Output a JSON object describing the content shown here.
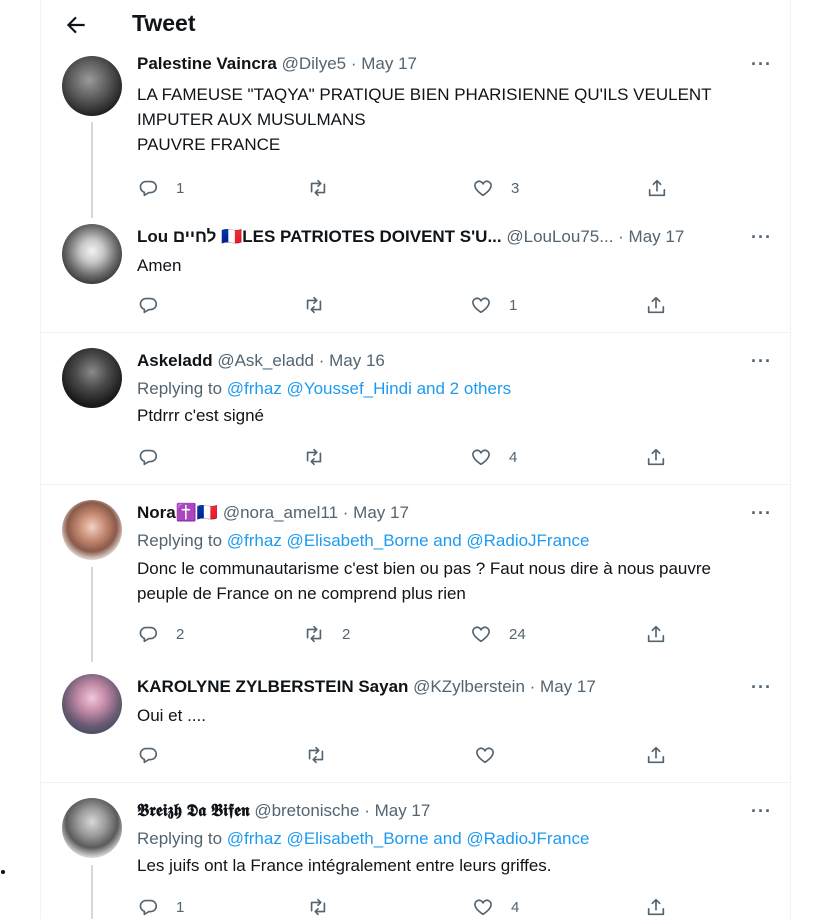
{
  "header": {
    "title": "Tweet"
  },
  "tweets": [
    {
      "name": "Palestine Vaincra",
      "handle": "@Dilye5",
      "date": "· May 17",
      "reply_prefix": "",
      "reply_links": "",
      "lines": [
        "LA FAMEUSE \"TAQYA\" PRATIQUE BIEN PHARISIENNE QU'ILS VEULENT",
        "IMPUTER AUX MUSULMANS",
        "PAUVRE FRANCE"
      ],
      "replies": "1",
      "retweets": "",
      "likes": "3"
    },
    {
      "name": "Lou לחיים 🇫🇷LES PATRIOTES DOIVENT S'U...",
      "handle": "@LouLou75...",
      "date": "· May 17",
      "reply_prefix": "",
      "reply_links": "",
      "lines": [
        "Amen"
      ],
      "replies": "",
      "retweets": "",
      "likes": "1"
    },
    {
      "name": "Askeladd",
      "handle": "@Ask_eladd",
      "date": "· May 16",
      "reply_prefix": "Replying to ",
      "reply_links": "@frhaz @Youssef_Hindi and 2 others",
      "lines": [
        "Ptdrrr c'est signé"
      ],
      "replies": "",
      "retweets": "",
      "likes": "4"
    },
    {
      "name": "Nora✝️🇫🇷",
      "handle": "@nora_amel11",
      "date": "· May 17",
      "reply_prefix": "Replying to ",
      "reply_links": "@frhaz @Elisabeth_Borne and @RadioJFrance",
      "lines": [
        "Donc le communautarisme c'est bien ou pas ? Faut nous dire à nous pauvre",
        "peuple de France on ne comprend plus rien"
      ],
      "replies": "2",
      "retweets": "2",
      "likes": "24"
    },
    {
      "name": "KAROLYNE ZYLBERSTEIN Sayan",
      "handle": "@KZylberstein",
      "date": "· May 17",
      "reply_prefix": "",
      "reply_links": "",
      "lines": [
        "Oui et ...."
      ],
      "replies": "",
      "retweets": "",
      "likes": ""
    },
    {
      "name": "𝕭𝖗𝖊𝖎𝖟𝖍 𝕯𝖆 𝕭𝖎𝖋𝖊𝖓",
      "handle": "@bretonische",
      "date": "· May 17",
      "reply_prefix": "Replying to ",
      "reply_links": "@frhaz @Elisabeth_Borne and @RadioJFrance",
      "lines": [
        "Les juifs ont la France intégralement entre leurs griffes."
      ],
      "replies": "1",
      "retweets": "",
      "likes": "4"
    }
  ],
  "icons": {
    "back": "arrow-left-icon",
    "reply": "reply-icon",
    "retweet": "retweet-icon",
    "like": "heart-icon",
    "share": "share-icon",
    "more": "more-icon"
  },
  "colors": {
    "link": "#1d9bf0",
    "secondary": "#536471",
    "text": "#0f1419",
    "divider": "#eff3f4"
  }
}
